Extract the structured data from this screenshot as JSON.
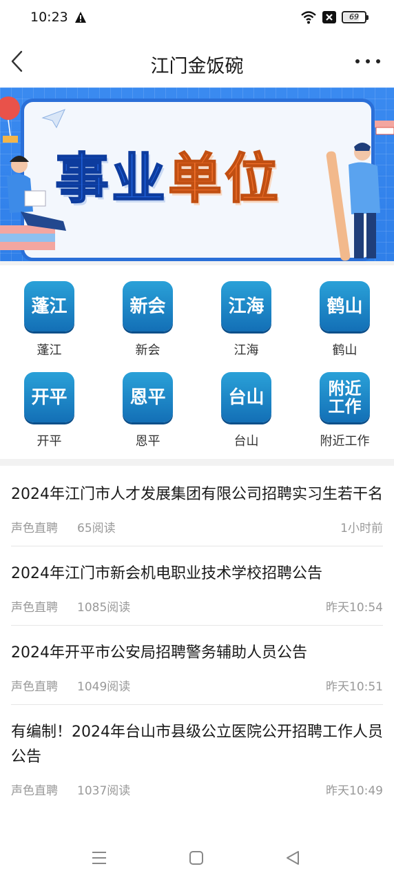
{
  "status_bar": {
    "time": "10:23",
    "battery": "69",
    "battery_level": 0.69
  },
  "header": {
    "title": "江门金饭碗"
  },
  "banner": {
    "text_part1": "事业",
    "text_part2": "单位"
  },
  "regions": [
    {
      "tile": "蓬江",
      "label": "蓬江"
    },
    {
      "tile": "新会",
      "label": "新会"
    },
    {
      "tile": "江海",
      "label": "江海"
    },
    {
      "tile": "鹤山",
      "label": "鹤山"
    },
    {
      "tile": "开平",
      "label": "开平"
    },
    {
      "tile": "恩平",
      "label": "恩平"
    },
    {
      "tile": "台山",
      "label": "台山"
    },
    {
      "tile": "附近工作",
      "label": "附近工作"
    }
  ],
  "articles": [
    {
      "title": "2024年江门市人才发展集团有限公司招聘实习生若干名",
      "source": "声色直聘",
      "reads": "65阅读",
      "time": "1小时前"
    },
    {
      "title": "2024年江门市新会机电职业技术学校招聘公告",
      "source": "声色直聘",
      "reads": "1085阅读",
      "time": "昨天10:54"
    },
    {
      "title": "2024年开平市公安局招聘警务辅助人员公告",
      "source": "声色直聘",
      "reads": "1049阅读",
      "time": "昨天10:51"
    },
    {
      "title": "有编制！2024年台山市县级公立医院公开招聘工作人员公告",
      "source": "声色直聘",
      "reads": "1037阅读",
      "time": "昨天10:49"
    }
  ],
  "colors": {
    "accent_blue": "#1f5fd8",
    "accent_orange": "#f1702a",
    "tile_blue": "#136fb6"
  },
  "icons": [
    "warning-icon",
    "wifi-icon",
    "close-box-icon",
    "battery-icon",
    "back-icon",
    "more-icon",
    "menu-nav-icon",
    "home-nav-icon",
    "back-nav-icon"
  ]
}
